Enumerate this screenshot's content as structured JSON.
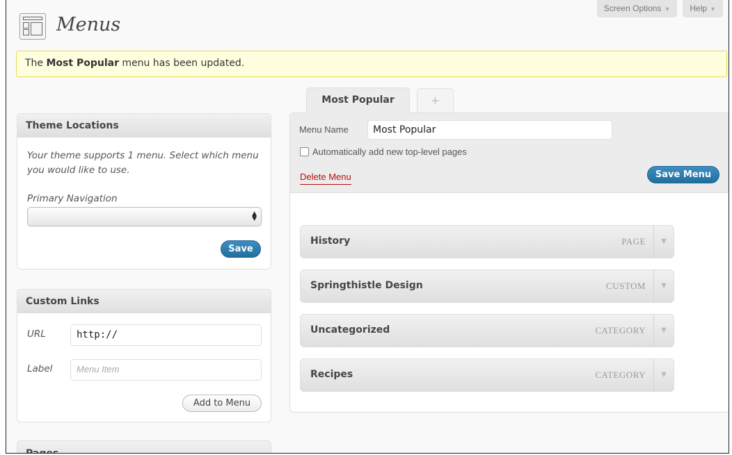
{
  "header": {
    "title": "Menus",
    "screen_options_label": "Screen Options",
    "help_label": "Help",
    "dropdown_arrow": "▼"
  },
  "notice": {
    "prefix": "The ",
    "menu_name": "Most Popular",
    "suffix": " menu has been updated."
  },
  "theme_locations": {
    "title": "Theme Locations",
    "description": "Your theme supports 1 menu. Select which menu you would like to use.",
    "primary_label": "Primary Navigation",
    "selected_value": "",
    "save_label": "Save"
  },
  "custom_links": {
    "title": "Custom Links",
    "url_label": "URL",
    "url_value": "http://",
    "label_label": "Label",
    "label_placeholder": "Menu Item",
    "add_label": "Add to Menu"
  },
  "pages_box": {
    "title": "Pages"
  },
  "tabs": {
    "active_label": "Most Popular",
    "new_label": "+"
  },
  "editor": {
    "menu_name_label": "Menu Name",
    "menu_name_value": "Most Popular",
    "auto_add_label": "Automatically add new top-level pages",
    "auto_add_checked": false,
    "delete_label": "Delete Menu",
    "save_label": "Save Menu"
  },
  "menu_items": [
    {
      "title": "History",
      "type": "PAGE"
    },
    {
      "title": "Springthistle Design",
      "type": "CUSTOM"
    },
    {
      "title": "Uncategorized",
      "type": "CATEGORY"
    },
    {
      "title": "Recipes",
      "type": "CATEGORY"
    }
  ],
  "colors": {
    "primary_button": "#216f9f",
    "notice_bg": "#ffffe0",
    "delete_link": "#bc0b0b"
  }
}
